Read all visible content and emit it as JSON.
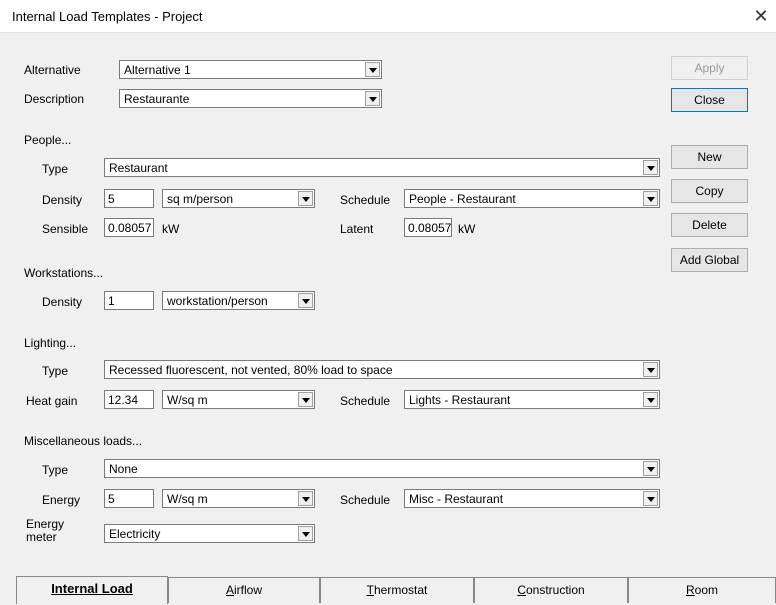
{
  "window": {
    "title": "Internal Load Templates - Project",
    "close_glyph": "✕"
  },
  "alternative": {
    "label": "Alternative",
    "value": "Alternative 1"
  },
  "description": {
    "label": "Description",
    "value": "Restaurante"
  },
  "people": {
    "heading": "People...",
    "type_label": "Type",
    "type_value": "Restaurant",
    "density_label": "Density",
    "density_value": "5",
    "density_unit": "sq m/person",
    "schedule_label": "Schedule",
    "schedule_value": "People - Restaurant",
    "sensible_label": "Sensible",
    "sensible_value": "0.08057",
    "sensible_unit": "kW",
    "latent_label": "Latent",
    "latent_value": "0.08057",
    "latent_unit": "kW"
  },
  "workstations": {
    "heading": "Workstations...",
    "density_label": "Density",
    "density_value": "1",
    "density_unit": "workstation/person"
  },
  "lighting": {
    "heading": "Lighting...",
    "type_label": "Type",
    "type_value": "Recessed fluorescent, not vented, 80% load to space",
    "heatgain_label": "Heat gain",
    "heatgain_value": "12.34",
    "heatgain_unit": "W/sq m",
    "schedule_label": "Schedule",
    "schedule_value": "Lights - Restaurant"
  },
  "misc": {
    "heading": "Miscellaneous loads...",
    "type_label": "Type",
    "type_value": "None",
    "energy_label": "Energy",
    "energy_value": "5",
    "energy_unit": "W/sq m",
    "schedule_label": "Schedule",
    "schedule_value": "Misc - Restaurant",
    "meter_label_1": "Energy",
    "meter_label_2": "meter",
    "meter_value": "Electricity"
  },
  "buttons": {
    "apply": "Apply",
    "close": "Close",
    "new": "New",
    "copy": "Copy",
    "delete": "Delete",
    "add_global": "Add Global"
  },
  "tabs": {
    "internal_load": "Internal Load",
    "airflow_u": "A",
    "airflow_rest": "irflow",
    "thermostat_u": "T",
    "thermostat_rest": "hermostat",
    "construction_u": "C",
    "construction_rest": "onstruction",
    "room_u": "R",
    "room_rest": "oom"
  }
}
